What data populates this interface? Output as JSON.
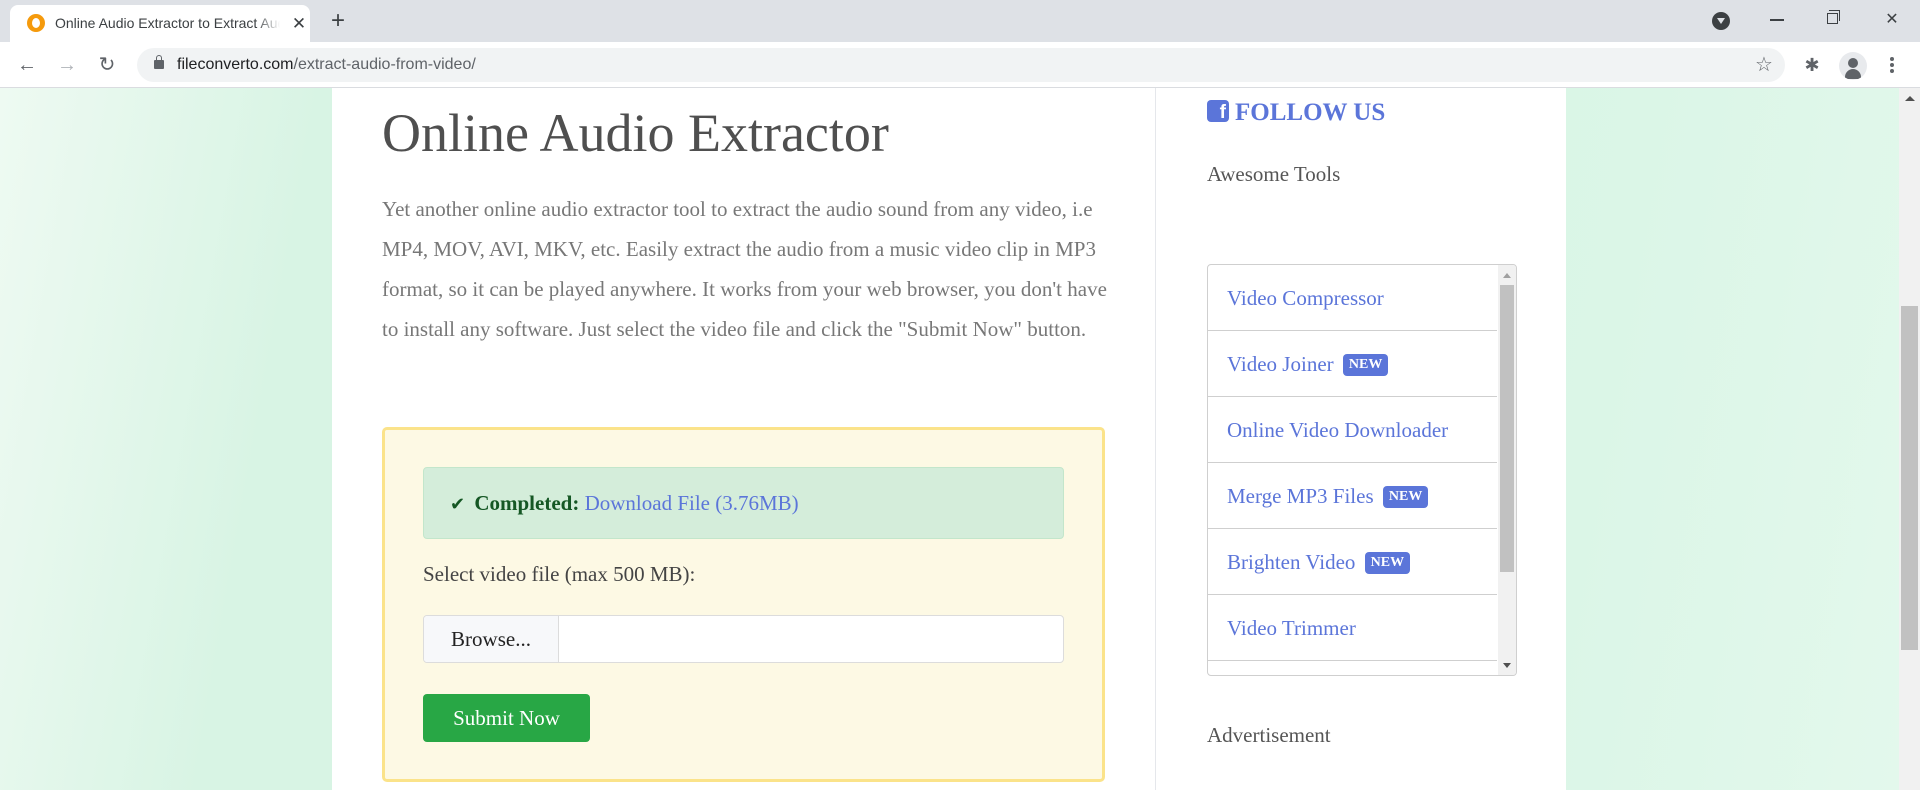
{
  "browser": {
    "tab_title": "Online Audio Extractor to Extract Audio from Video",
    "tab_close": "✕",
    "new_tab": "+",
    "url_host": "fileconverto.com",
    "url_path": "/extract-audio-from-video/",
    "icons": {
      "back": "←",
      "forward": "→",
      "reload": "↻",
      "star": "☆",
      "extensions": "✱",
      "close_window": "✕"
    }
  },
  "main": {
    "title": "Online Audio Extractor",
    "intro": "Yet another online audio extractor tool to extract the audio sound from any video, i.e MP4, MOV, AVI, MKV, etc. Easily extract the audio from a music video clip in MP3 format, so it can be played anywhere. It works from your web browser, you don't have to install any software. Just select the video file and click the \"Submit Now\" button.",
    "alert": {
      "icon": "✔",
      "status": "Completed:",
      "link_label": "Download File (3.76MB)",
      "status_color": "#155724"
    },
    "file_label": "Select video file (max 500 MB):",
    "browse_label": "Browse...",
    "file_value": "",
    "submit_label": "Submit Now"
  },
  "sidebar": {
    "follow_label": "FOLLOW US",
    "tools_heading": "Awesome Tools",
    "tools": [
      {
        "label": "Video Compressor",
        "badge": ""
      },
      {
        "label": "Video Joiner",
        "badge": "NEW"
      },
      {
        "label": "Online Video Downloader",
        "badge": ""
      },
      {
        "label": "Merge MP3 Files",
        "badge": "NEW"
      },
      {
        "label": "Brighten Video",
        "badge": "NEW"
      },
      {
        "label": "Video Trimmer",
        "badge": ""
      }
    ],
    "ad_heading": "Advertisement"
  },
  "colors": {
    "accent": "#5b75d9",
    "submit": "#28a745",
    "upload_bg": "#fdf9e4",
    "upload_border": "#fbe38a"
  }
}
